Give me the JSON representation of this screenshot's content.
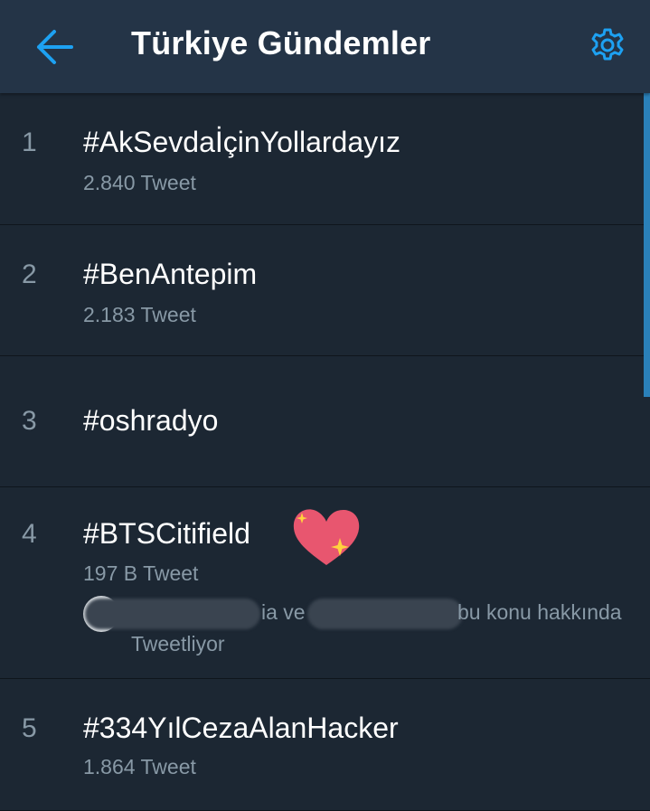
{
  "header": {
    "title": "Türkiye Gündemler",
    "back_icon": "arrow-left-icon",
    "settings_icon": "gear-icon",
    "accent_color": "#1da1f2"
  },
  "trends": [
    {
      "rank": "1",
      "hashtag": "#AkSevdaİçinYollardayız",
      "count": "2.840 Tweet"
    },
    {
      "rank": "2",
      "hashtag": "#BenAntepim",
      "count": "2.183 Tweet"
    },
    {
      "rank": "3",
      "hashtag": "#oshradyo"
    },
    {
      "rank": "4",
      "hashtag": "#BTSCitifield",
      "count": "197 B Tweet",
      "emoji_icon": "sparkling-heart-icon",
      "context": {
        "part1": "ia ve",
        "part2": "bu konu hakkında",
        "part3": "Tweetliyor"
      }
    },
    {
      "rank": "5",
      "hashtag": "#334YılCezaAlanHacker",
      "count": "1.864 Tweet"
    }
  ],
  "colors": {
    "background": "#1c2733",
    "header": "#243447",
    "primary_text": "#ffffff",
    "secondary_text": "#8899a6"
  }
}
